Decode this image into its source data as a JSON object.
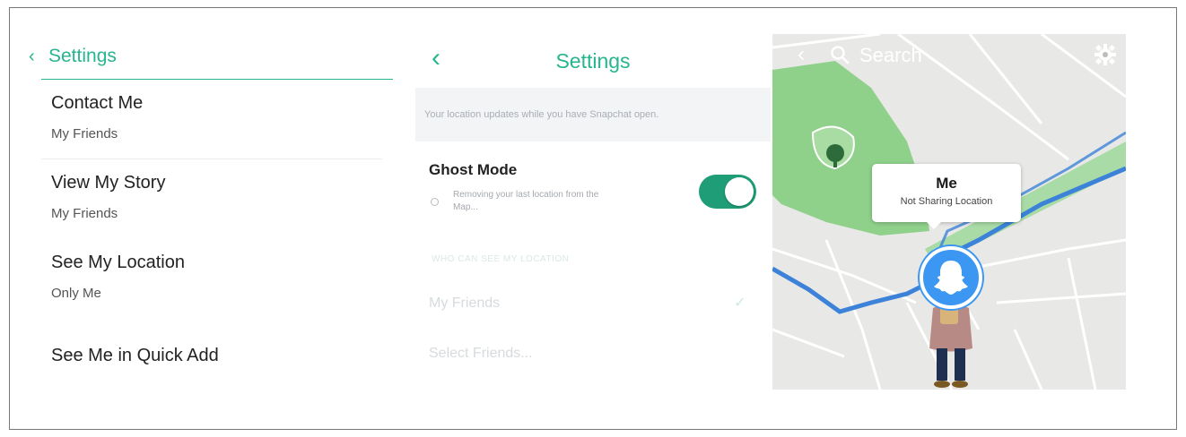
{
  "panel_left": {
    "back_icon": "chevron-left-icon",
    "title": "Settings",
    "items": [
      {
        "label": "Contact Me",
        "value": "My Friends"
      },
      {
        "label": "View My Story",
        "value": "My Friends"
      },
      {
        "label": "See My Location",
        "value": "Only Me"
      },
      {
        "label": "See Me in Quick Add",
        "value": ""
      }
    ]
  },
  "panel_middle": {
    "back_icon": "chevron-left-icon",
    "title": "Settings",
    "info_text": "Your location updates while you have Snapchat open.",
    "ghost_mode": {
      "label": "Ghost Mode",
      "description": "Removing your last location from the Map...",
      "enabled": true
    },
    "section_header": "WHO CAN SEE MY LOCATION",
    "options": [
      {
        "label": "My Friends",
        "selected": true
      },
      {
        "label": "Select Friends...",
        "selected": false
      }
    ]
  },
  "panel_map": {
    "back_icon": "chevron-left-icon",
    "search_icon": "search-icon",
    "search_placeholder": "Search",
    "settings_icon": "gear-icon",
    "user_card": {
      "name": "Me",
      "status": "Not Sharing Location"
    },
    "avatar_icon": "ghost-icon"
  },
  "colors": {
    "accent": "#27b58f",
    "toggle_on": "#1f9d77",
    "map_route": "#3b82d8",
    "park": "#7cc77a",
    "avatar_bg": "#3b97f2"
  }
}
